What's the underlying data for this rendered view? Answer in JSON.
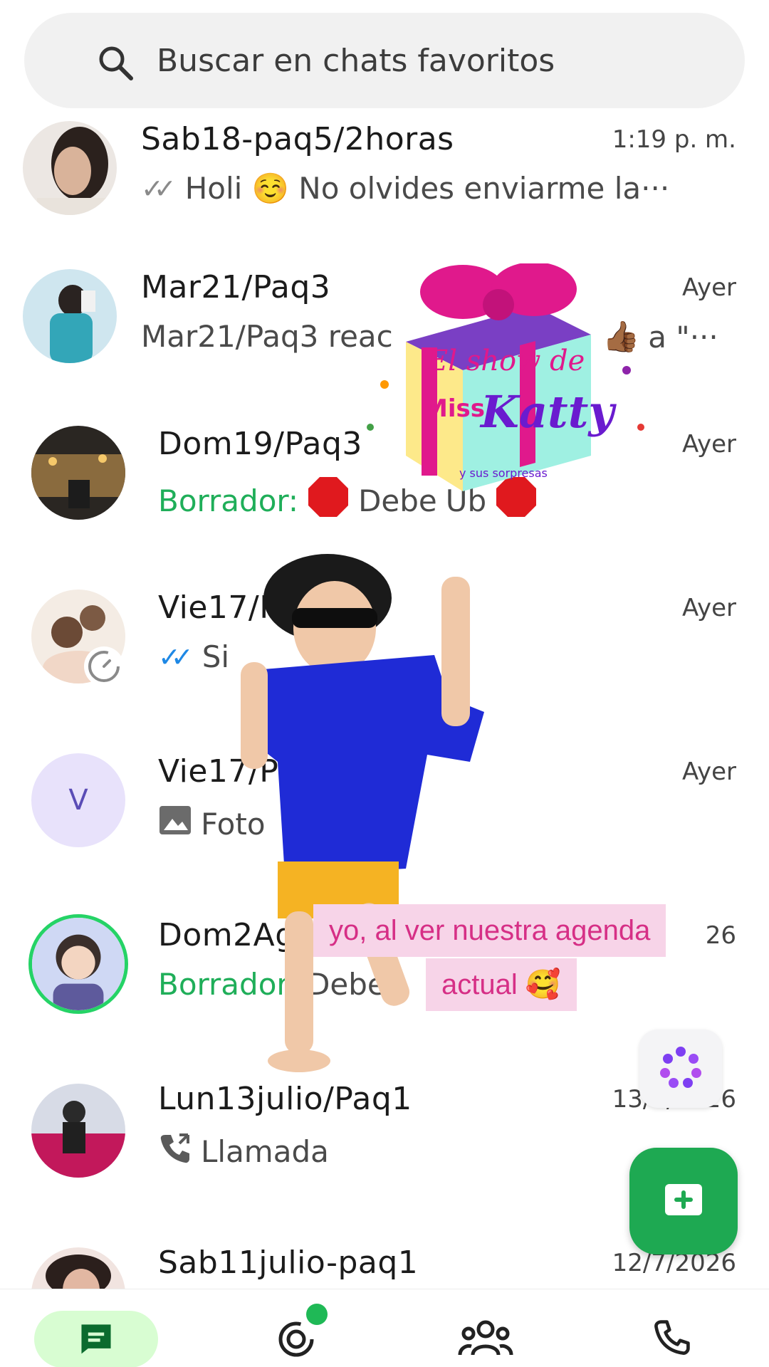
{
  "search": {
    "placeholder": "Buscar en chats favoritos"
  },
  "chats": [
    {
      "name": "Sab18-paq5/2horas",
      "time": "1:19 p. m.",
      "preview": "Holi ☺️ No olvides enviarme la···",
      "status": "read-grey"
    },
    {
      "name": "Mar21/Paq3",
      "time": "Ayer",
      "preview": "Mar21/Paq3 reac",
      "preview_tail": "a \"···",
      "reaction": "👍🏾"
    },
    {
      "name": "Dom19/Paq3",
      "time": "Ayer",
      "draft_label": "Borrador:",
      "preview": "Debe",
      "preview_tail": "Ub"
    },
    {
      "name": "Vie17/Paq1",
      "time": "Ayer",
      "preview": "Si",
      "status": "read-blue"
    },
    {
      "name": "Vie17/Paq",
      "time": "Ayer",
      "preview": "Foto",
      "avatar_letter": "V"
    },
    {
      "name": "Dom2Agos",
      "time": "26",
      "draft_label": "Borrador:",
      "preview": "Debe"
    },
    {
      "name": "Lun13julio/Paq1",
      "time": "13/7/2026",
      "preview": "Llamada"
    },
    {
      "name": "Sab11julio-paq1",
      "time": "12/7/2026"
    }
  ],
  "overlay": {
    "caption_line1": "yo, al ver nuestra agenda",
    "caption_line2": "actual 🥰",
    "gift_text_1": "El show de",
    "gift_text_2": "Miss",
    "gift_text_3": "Katty",
    "gift_text_4": "y sus sorpresas"
  },
  "colors": {
    "accent": "#1ea952",
    "draft": "#1fae59",
    "caption_bg": "#f7d4e8",
    "caption_text": "#d62f86",
    "nav_active": "#d8fdd2"
  },
  "nav": [
    {
      "icon": "chats-icon",
      "active": true
    },
    {
      "icon": "updates-icon",
      "badge": true
    },
    {
      "icon": "communities-icon"
    },
    {
      "icon": "calls-icon"
    }
  ]
}
